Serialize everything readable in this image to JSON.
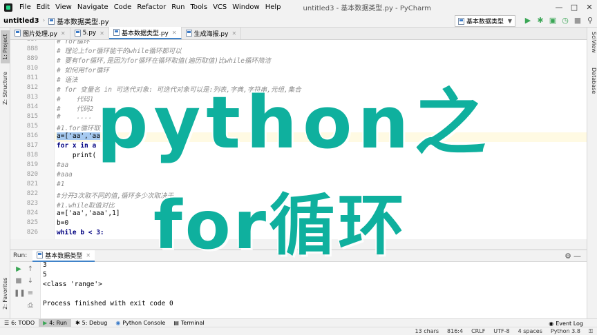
{
  "window": {
    "title": "untitled3 - 基本数据类型.py - PyCharm",
    "menu": [
      "File",
      "Edit",
      "View",
      "Navigate",
      "Code",
      "Refactor",
      "Run",
      "Tools",
      "VCS",
      "Window",
      "Help"
    ]
  },
  "navbar": {
    "project": "untitled3",
    "file": "基本数据类型.py",
    "run_config": "基本数据类型"
  },
  "left_tool_tabs": [
    "1: Project",
    "Z: Structure",
    "2: Favorites"
  ],
  "right_tool_tabs": [
    "SciView",
    "Database"
  ],
  "editor_tabs": [
    {
      "label": "图片处理.py",
      "active": false
    },
    {
      "label": "5.py",
      "active": false
    },
    {
      "label": "基本数据类型.py",
      "active": true
    },
    {
      "label": "生成海报.py",
      "active": false
    }
  ],
  "code_lines": [
    {
      "no": "887",
      "text": "# for循环"
    },
    {
      "no": "888",
      "text": "# 理论上for循环能干的while循环都可以"
    },
    {
      "no": "889",
      "text": "# 要有for循环,是因为for循环在循环取值(遍历取值)比while循环简洁"
    },
    {
      "no": "810",
      "text": "# 如何用for循环"
    },
    {
      "no": "811",
      "text": "# 语法"
    },
    {
      "no": "812",
      "text": "# for 变量名 in 可迭代对象: 可迭代对象可以是:列表,字典,字符串,元组,集合"
    },
    {
      "no": "813",
      "text": "#    代码1"
    },
    {
      "no": "814",
      "text": "#    代码2"
    },
    {
      "no": "815",
      "text": "#    ...."
    },
    {
      "no": "815",
      "text": "#1.for循环取"
    },
    {
      "no": "816",
      "text": "a=['aa','aa"
    },
    {
      "no": "817",
      "text": "for x in a"
    },
    {
      "no": "818",
      "text": "    print("
    },
    {
      "no": "819",
      "text": "#aa"
    },
    {
      "no": "820",
      "text": "#aaa"
    },
    {
      "no": "821",
      "text": "#1"
    },
    {
      "no": "822",
      "text": "#分开3次取不同的值,循环多少次取决于"
    },
    {
      "no": "823",
      "text": "#1.while取值对比"
    },
    {
      "no": "824",
      "text": "a=['aa','aaa',1]"
    },
    {
      "no": "825",
      "text": "b=0"
    },
    {
      "no": "826",
      "text": "while b < 3:"
    }
  ],
  "overlay": {
    "line1": "python之",
    "line2": "for循环"
  },
  "run_panel": {
    "label": "Run:",
    "tab": "基本数据类型",
    "output": [
      "3",
      "5",
      "<class 'range'>",
      "",
      "Process finished with exit code 0"
    ]
  },
  "bottom_tabs": [
    {
      "label": "6: TODO",
      "active": false,
      "icon": "todo-icon"
    },
    {
      "label": "4: Run",
      "active": true,
      "icon": "run-icon"
    },
    {
      "label": "5: Debug",
      "active": false,
      "icon": "debug-icon"
    },
    {
      "label": "Python Console",
      "active": false,
      "icon": "python-console-icon"
    },
    {
      "label": "Terminal",
      "active": false,
      "icon": "terminal-icon"
    }
  ],
  "event_log": "Event Log",
  "status": {
    "chars": "13 chars",
    "position": "816:4",
    "line_sep": "CRLF",
    "encoding": "UTF-8",
    "indent": "4 spaces",
    "interpreter": "Python 3.8"
  }
}
